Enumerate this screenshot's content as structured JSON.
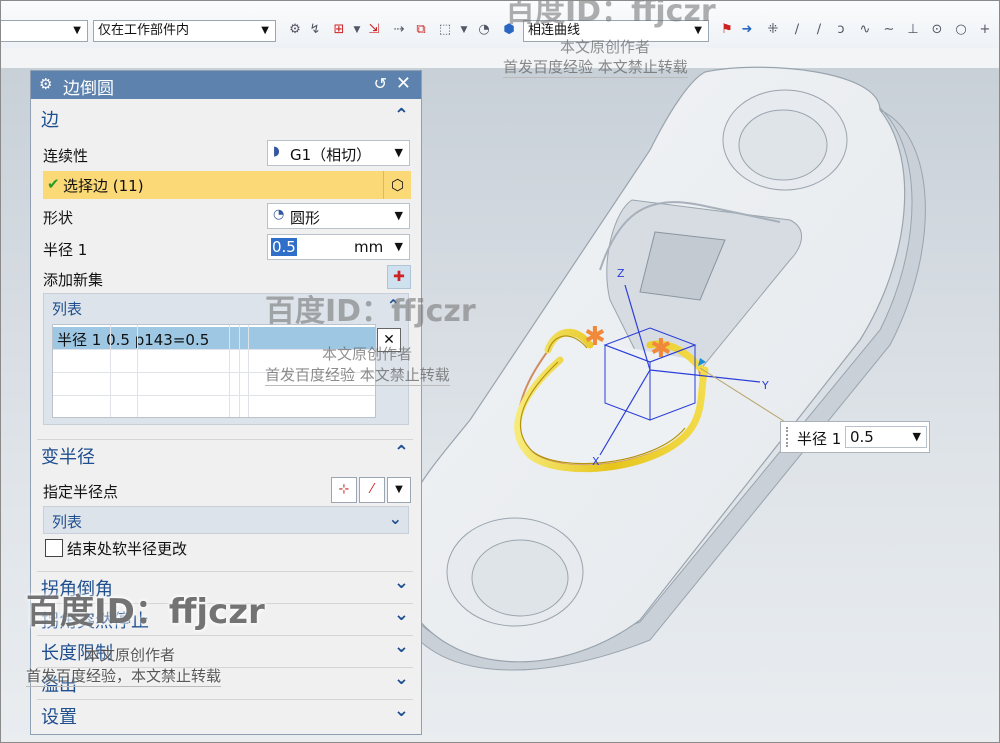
{
  "toolbar": {
    "filter_value": "",
    "scope_value": "仅在工作部件内",
    "curve_rule_value": "相连曲线"
  },
  "dialog": {
    "title": "边倒圆",
    "edge_section": {
      "title": "边",
      "continuity_label": "连续性",
      "continuity_value": "G1（相切）",
      "select_edge_label": "选择边 (11)",
      "shape_label": "形状",
      "shape_value": "圆形",
      "radius_label": "半径 1",
      "radius_value": "0.5",
      "radius_unit": "mm",
      "add_new_set_label": "添加新集",
      "list": {
        "title": "列表",
        "rows": [
          "半径 1  0.5  p143=0.5"
        ]
      }
    },
    "variable_radius_section": {
      "title": "变半径",
      "specify_point_label": "指定半径点",
      "list_title": "列表",
      "soft_radius_checkbox_label": "结束处软半径更改",
      "soft_radius_checked": false
    },
    "collapsed_sections": [
      "拐角倒角",
      "拐角突然停止",
      "长度限制",
      "溢出",
      "设置"
    ]
  },
  "callout": {
    "label": "半径 1",
    "value": "0.5"
  },
  "axes": {
    "x": "X",
    "y": "Y",
    "z": "Z"
  },
  "watermark": {
    "id_text": "百度ID：ffjczr",
    "author": "本文原创作者",
    "notice": "首发百度经验    本文禁止转载",
    "notice2": "首发百度经验，本文禁止转载"
  },
  "colors": {
    "title_bar": "#5d82ad",
    "section_text": "#1f4f8f",
    "selection_highlight": "#fcd977",
    "selected_row": "#9dc7e2",
    "fillet_face": "#f0d828"
  }
}
